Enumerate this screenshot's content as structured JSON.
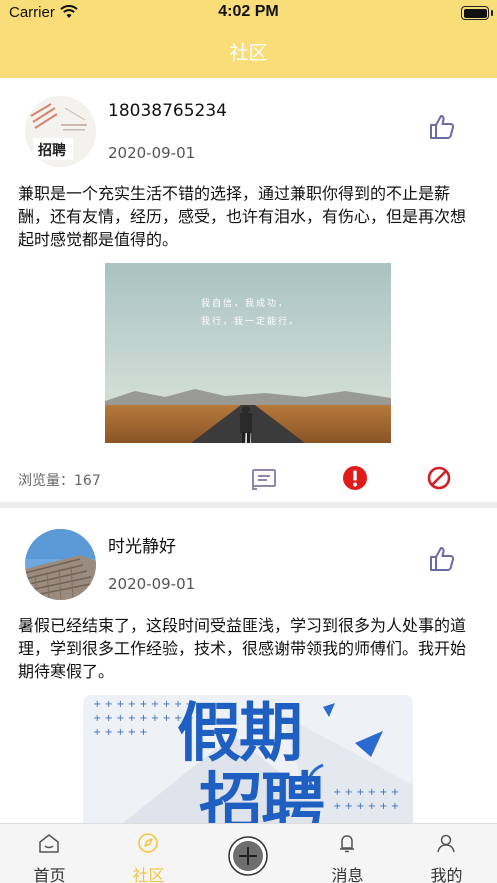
{
  "status_bar": {
    "carrier": "Carrier",
    "time": "4:02 PM"
  },
  "nav": {
    "title": "社区"
  },
  "posts": [
    {
      "username": "18038765234",
      "date": "2020-09-01",
      "avatar_text": "招聘",
      "content": "兼职是一个充实生活不错的选择，通过兼职你得到的不止是薪酬，还有友情，经历，感受，也许有泪水，有伤心，但是再次想起时感觉都是值得的。",
      "image_caption_line1": "我自信，我成功，",
      "image_caption_line2": "我行，我一定能行。",
      "views_label": "浏览量：",
      "views": "167"
    },
    {
      "username": "时光静好",
      "date": "2020-09-01",
      "content": "暑假已经结束了，这段时间受益匪浅，学习到很多为人处事的道理，学到很多工作经验，技术，很感谢带领我的师傅们。我开始期待寒假了。",
      "image_title_line1": "假期",
      "image_title_line2": "招聘"
    }
  ],
  "tabbar": {
    "tabs": [
      {
        "label": "首页",
        "icon": "home-icon"
      },
      {
        "label": "社区",
        "icon": "community-icon",
        "active": true
      },
      {
        "label": "",
        "icon": "add-icon"
      },
      {
        "label": "消息",
        "icon": "bell-icon"
      },
      {
        "label": "我的",
        "icon": "profile-icon"
      }
    ]
  },
  "colors": {
    "accent": "#f9dd79",
    "active_tab": "#f3c545",
    "icon_purple": "#6a6aa6",
    "report_red": "#e11b1b"
  }
}
